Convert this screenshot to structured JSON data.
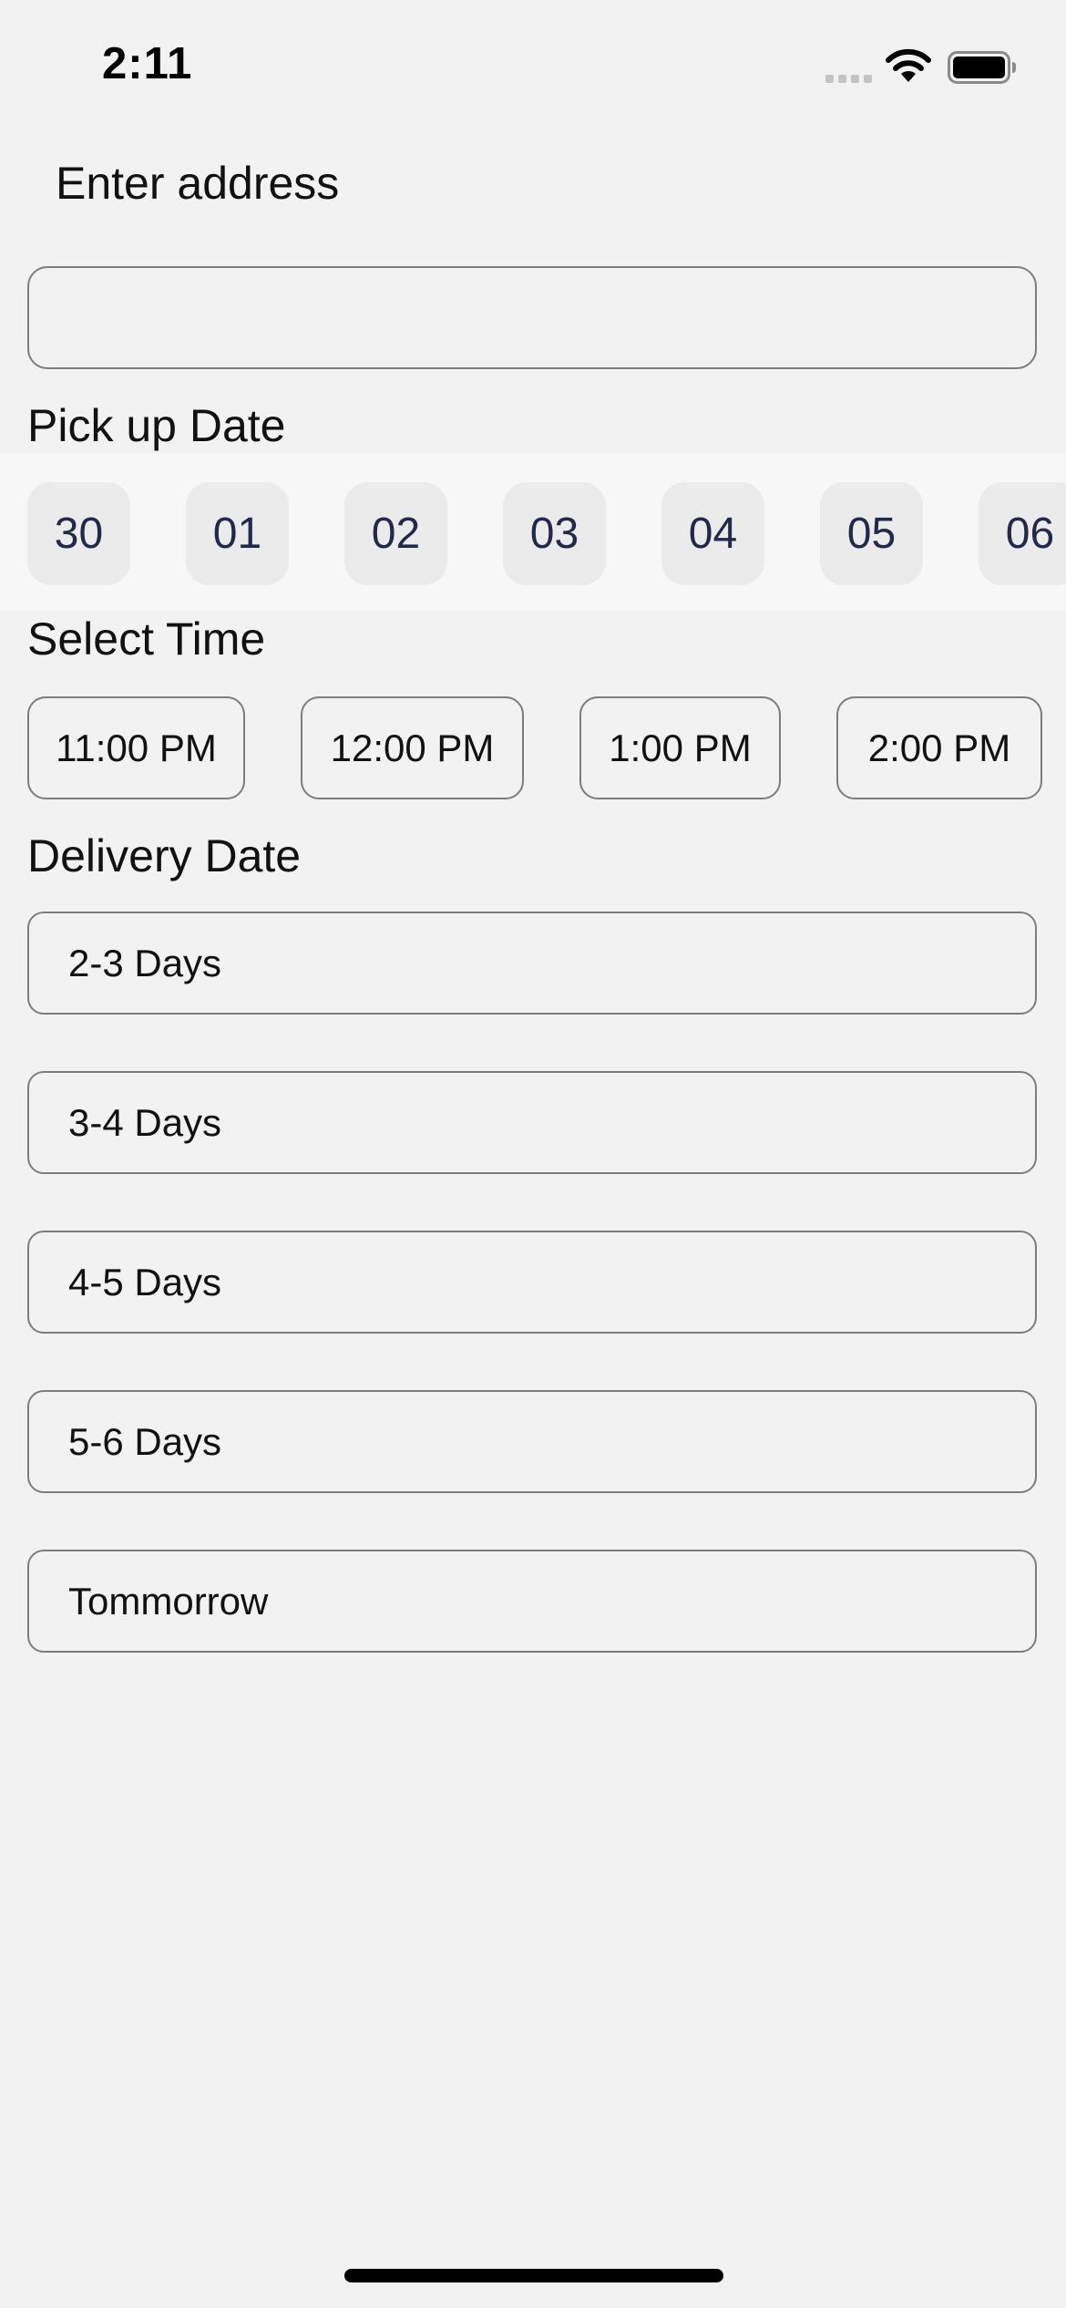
{
  "status_bar": {
    "time": "2:11"
  },
  "page_title": "Enter address",
  "address": {
    "value": "",
    "placeholder": ""
  },
  "pickup": {
    "heading": "Pick up Date",
    "dates": [
      "30",
      "01",
      "02",
      "03",
      "04",
      "05",
      "06"
    ]
  },
  "time": {
    "heading": "Select Time",
    "slots": [
      "11:00 PM",
      "12:00 PM",
      "1:00 PM",
      "2:00 PM"
    ]
  },
  "delivery": {
    "heading": "Delivery Date",
    "options": [
      "2-3 Days",
      "3-4 Days",
      "4-5 Days",
      "5-6 Days",
      "Tommorrow"
    ]
  },
  "icons": {
    "signal": "cellular-signal-icon",
    "wifi": "wifi-icon",
    "battery": "battery-icon"
  },
  "colors": {
    "background": "#f2f2f2",
    "date_text": "#23294a",
    "border": "#7d7d7d"
  }
}
